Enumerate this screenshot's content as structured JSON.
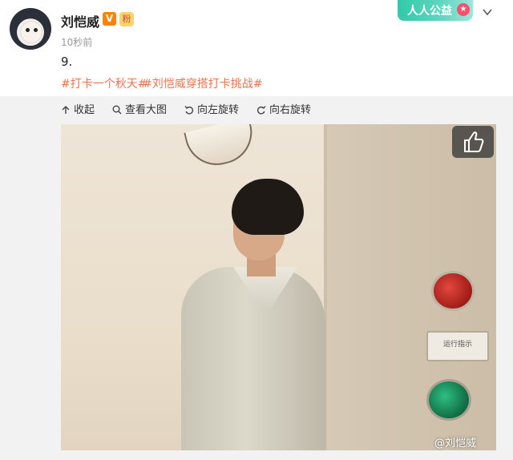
{
  "post": {
    "author": "刘恺威",
    "verified_badge": "V",
    "fan_badge": "粉",
    "timestamp": "10秒前",
    "text": "9.",
    "topics": [
      "#打卡一个秋天#",
      "#刘恺威穿搭打卡挑战#"
    ]
  },
  "header_badge": {
    "label": "人人公益",
    "star": "★"
  },
  "toolbar": {
    "collapse_label": "收起",
    "view_large_label": "查看大图",
    "rotate_left_label": "向左旋转",
    "rotate_right_label": "向右旋转"
  },
  "photo": {
    "plate_text": "运行指示",
    "watermark": "@刘恺威"
  },
  "icons": {
    "collapse": "arrow-up-icon",
    "view_large": "magnifier-icon",
    "rotate_left": "rotate-left-icon",
    "rotate_right": "rotate-right-icon",
    "like": "thumbs-up-icon",
    "more": "chevron-down-icon"
  },
  "colors": {
    "topic": "#eb7350",
    "verified": "#ff8200"
  }
}
